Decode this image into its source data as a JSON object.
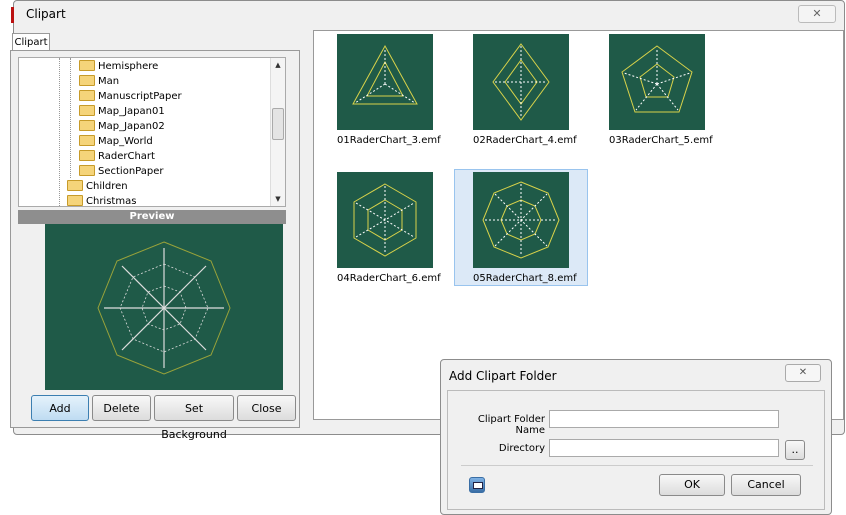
{
  "window": {
    "title": "Clipart",
    "tab_label": "Clipart"
  },
  "tree": {
    "items": [
      {
        "label": "Hemisphere",
        "level": 2
      },
      {
        "label": "Man",
        "level": 2
      },
      {
        "label": "ManuscriptPaper",
        "level": 2
      },
      {
        "label": "Map_Japan01",
        "level": 2
      },
      {
        "label": "Map_Japan02",
        "level": 2
      },
      {
        "label": "Map_World",
        "level": 2
      },
      {
        "label": "RaderChart",
        "level": 2
      },
      {
        "label": "SectionPaper",
        "level": 2
      },
      {
        "label": "Children",
        "level": 1
      },
      {
        "label": "Christmas",
        "level": 1
      }
    ]
  },
  "preview": {
    "header": "Preview"
  },
  "buttons": {
    "add": "Add",
    "delete": "Delete",
    "set_background": "Set Background",
    "close": "Close"
  },
  "thumbnails": [
    {
      "label": "01RaderChart_3.emf",
      "selected": false
    },
    {
      "label": "02RaderChart_4.emf",
      "selected": false
    },
    {
      "label": "03RaderChart_5.emf",
      "selected": false
    },
    {
      "label": "04RaderChart_6.emf",
      "selected": false
    },
    {
      "label": "05RaderChart_8.emf",
      "selected": true
    }
  ],
  "dialog": {
    "title": "Add Clipart Folder",
    "folder_name_label": "Clipart Folder Name",
    "folder_name_value": "",
    "directory_label": "Directory",
    "directory_value": "",
    "browse_label": "..",
    "ok": "OK",
    "cancel": "Cancel"
  },
  "colors": {
    "thumb_bg": "#1f5a48",
    "outline": "#d8d24a",
    "spoke": "#ffffff",
    "selection": "#dce9f7"
  },
  "icons": {
    "close": "close-icon",
    "folder": "folder-icon",
    "dialog_icon": "folder-dialog-icon"
  }
}
